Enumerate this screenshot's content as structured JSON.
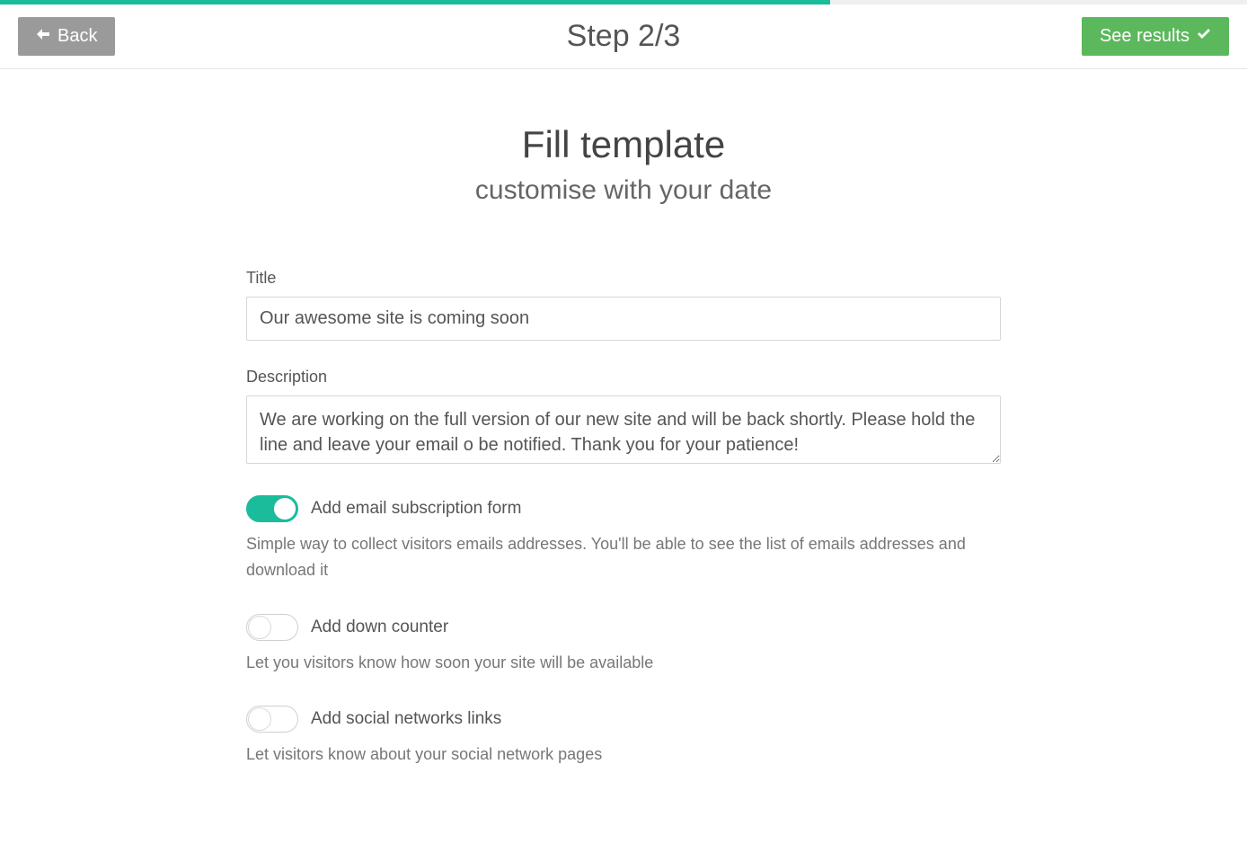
{
  "progress": {
    "percent": 66.6
  },
  "header": {
    "back_label": "Back",
    "step_title": "Step 2/3",
    "results_label": "See results"
  },
  "page": {
    "heading": "Fill template",
    "subheading": "customise with your date"
  },
  "form": {
    "title": {
      "label": "Title",
      "value": "Our awesome site is coming soon"
    },
    "description": {
      "label": "Description",
      "value": "We are working on the full version of our new site and will be back shortly. Please hold the line and leave your email o be notified. Thank you for your patience!"
    },
    "toggles": [
      {
        "on": true,
        "label": "Add email subscription form",
        "description": "Simple way to collect visitors emails addresses. You'll be able to see the list of emails addresses and download it"
      },
      {
        "on": false,
        "label": "Add down counter",
        "description": "Let you visitors know how soon your site will be available"
      },
      {
        "on": false,
        "label": "Add social networks links",
        "description": "Let visitors know about your social network pages"
      }
    ]
  }
}
